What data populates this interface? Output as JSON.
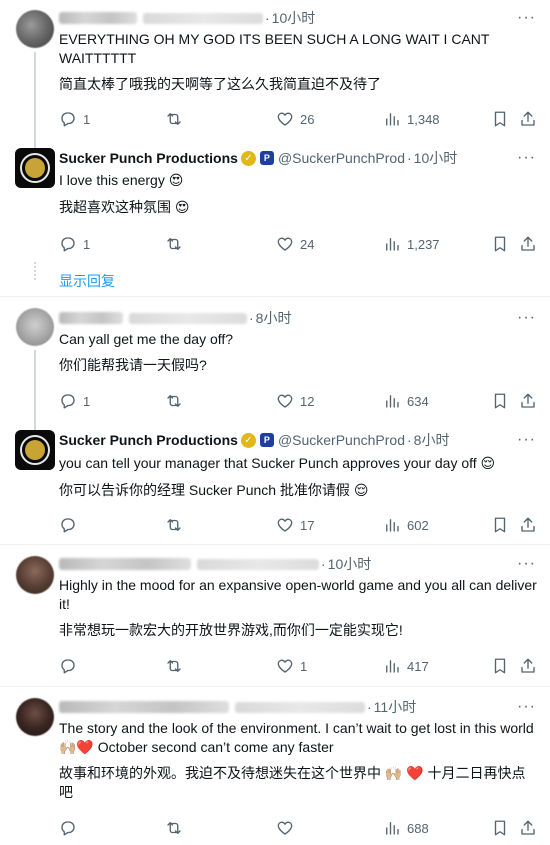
{
  "tweets": [
    {
      "time": "10小时",
      "text_en": "EVERYTHING OH MY GOD ITS BEEN SUCH A LONG WAIT I CANT WAITTTTTT",
      "text_zh": "简直太棒了哦我的天啊等了这么久我简直迫不及待了",
      "replies": "1",
      "likes": "26",
      "views": "1,348"
    },
    {
      "name": "Sucker Punch Productions",
      "handle": "@SuckerPunchProd",
      "time": "10小时",
      "text_en": "I love this energy 😍",
      "text_zh": "我超喜欢这种氛围 😍",
      "replies": "1",
      "likes": "24",
      "views": "1,237"
    },
    {
      "time": "8小时",
      "text_en": "Can yall get me the day off?",
      "text_zh": "你们能帮我请一天假吗?",
      "replies": "1",
      "likes": "12",
      "views": "634"
    },
    {
      "name": "Sucker Punch Productions",
      "handle": "@SuckerPunchProd",
      "time": "8小时",
      "text_en": "you can tell your manager that Sucker Punch approves your day off 😌",
      "text_zh": "你可以告诉你的经理 Sucker Punch 批准你请假 😌",
      "replies": "",
      "likes": "17",
      "views": "602"
    },
    {
      "time": "10小时",
      "text_en": "Highly in the mood for an expansive open-world game and you all can deliver it!",
      "text_zh": "非常想玩一款宏大的开放世界游戏,而你们一定能实现它!",
      "replies": "",
      "likes": "1",
      "views": "417"
    },
    {
      "time": "11小时",
      "text_en": "The story and the look of the environment. I can’t wait to get lost in this world 🙌🏼❤️ October second can’t come any faster",
      "text_zh": "故事和环境的外观。我迫不及待想迷失在这个世界中 🙌🏼 ❤️ 十月二日再快点吧",
      "replies": "",
      "likes": "",
      "views": "688"
    }
  ],
  "show_replies": "显示回复",
  "more_glyph": "···",
  "dot": "·",
  "icons": [
    "reply-icon",
    "retweet-icon",
    "like-icon",
    "views-icon",
    "bookmark-icon",
    "share-icon"
  ],
  "colors": {
    "link": "#1d9bf0",
    "muted": "#536471",
    "gold_badge": "#e2b719"
  }
}
